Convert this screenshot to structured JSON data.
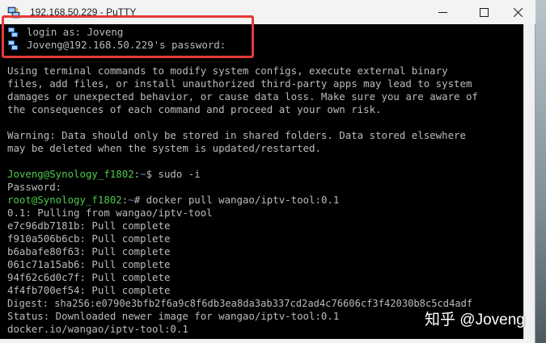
{
  "window": {
    "title": "192.168.50.229 - PuTTY",
    "controls": {
      "minimize": "—",
      "maximize": "☐",
      "close": "✕"
    }
  },
  "terminal": {
    "lines": [
      "login as: Joveng",
      "Joveng@192.168.50.229's password:",
      "",
      "Using terminal commands to modify system configs, execute external binary",
      "files, add files, or install unauthorized third-party apps may lead to system",
      "damages or unexpected behavior, or cause data loss. Make sure you are aware of",
      "the consequences of each command and proceed at your own risk.",
      "",
      "Warning: Data should only be stored in shared folders. Data stored elsewhere",
      "may be deleted when the system is updated/restarted.",
      "",
      "",
      "Password:",
      "",
      "0.1: Pulling from wangao/iptv-tool",
      "e7c96db7181b: Pull complete",
      "f910a506b6cb: Pull complete",
      "b6abafe80f63: Pull complete",
      "061c71a15ab6: Pull complete",
      "94f62c6d0c7f: Pull complete",
      "4f4fb700ef54: Pull complete",
      "Digest: sha256:e0790e3bfb2f6a9c8f6db3ea8da3ab337cd2ad4c76606cf3f42030b8c5cd4adf",
      "Status: Downloaded newer image for wangao/iptv-tool:0.1",
      "docker.io/wangao/iptv-tool:0.1"
    ],
    "prompt1": {
      "user": "Joveng@Synology_f1802",
      "sep": ":",
      "path": "~",
      "cmd": "$ sudo -i"
    },
    "prompt2": {
      "user": "root@Synology_f1802",
      "sep": ":",
      "path": "~",
      "cmd": "# docker pull wangao/iptv-tool:0.1"
    }
  },
  "watermark": "知乎 @Joveng",
  "colors": {
    "prompt_user": "#4ec94e",
    "prompt_path": "#5b8fd6",
    "text": "#bbbbbb",
    "highlight_box": "#e53935"
  }
}
